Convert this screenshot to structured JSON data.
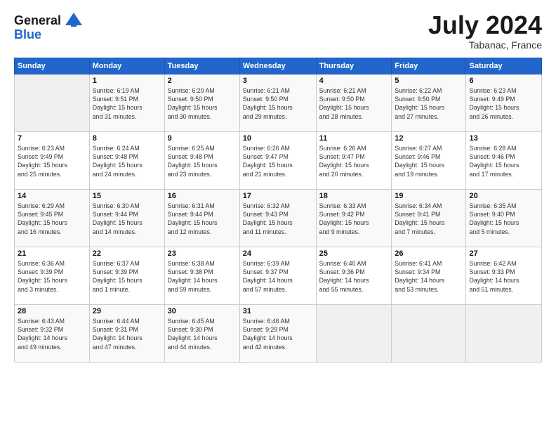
{
  "logo": {
    "general": "General",
    "blue": "Blue"
  },
  "title": "July 2024",
  "location": "Tabanac, France",
  "days_of_week": [
    "Sunday",
    "Monday",
    "Tuesday",
    "Wednesday",
    "Thursday",
    "Friday",
    "Saturday"
  ],
  "weeks": [
    [
      {
        "day": "",
        "detail": ""
      },
      {
        "day": "1",
        "detail": "Sunrise: 6:19 AM\nSunset: 9:51 PM\nDaylight: 15 hours\nand 31 minutes."
      },
      {
        "day": "2",
        "detail": "Sunrise: 6:20 AM\nSunset: 9:50 PM\nDaylight: 15 hours\nand 30 minutes."
      },
      {
        "day": "3",
        "detail": "Sunrise: 6:21 AM\nSunset: 9:50 PM\nDaylight: 15 hours\nand 29 minutes."
      },
      {
        "day": "4",
        "detail": "Sunrise: 6:21 AM\nSunset: 9:50 PM\nDaylight: 15 hours\nand 28 minutes."
      },
      {
        "day": "5",
        "detail": "Sunrise: 6:22 AM\nSunset: 9:50 PM\nDaylight: 15 hours\nand 27 minutes."
      },
      {
        "day": "6",
        "detail": "Sunrise: 6:23 AM\nSunset: 9:49 PM\nDaylight: 15 hours\nand 26 minutes."
      }
    ],
    [
      {
        "day": "7",
        "detail": "Sunrise: 6:23 AM\nSunset: 9:49 PM\nDaylight: 15 hours\nand 25 minutes."
      },
      {
        "day": "8",
        "detail": "Sunrise: 6:24 AM\nSunset: 9:48 PM\nDaylight: 15 hours\nand 24 minutes."
      },
      {
        "day": "9",
        "detail": "Sunrise: 6:25 AM\nSunset: 9:48 PM\nDaylight: 15 hours\nand 23 minutes."
      },
      {
        "day": "10",
        "detail": "Sunrise: 6:26 AM\nSunset: 9:47 PM\nDaylight: 15 hours\nand 21 minutes."
      },
      {
        "day": "11",
        "detail": "Sunrise: 6:26 AM\nSunset: 9:47 PM\nDaylight: 15 hours\nand 20 minutes."
      },
      {
        "day": "12",
        "detail": "Sunrise: 6:27 AM\nSunset: 9:46 PM\nDaylight: 15 hours\nand 19 minutes."
      },
      {
        "day": "13",
        "detail": "Sunrise: 6:28 AM\nSunset: 9:46 PM\nDaylight: 15 hours\nand 17 minutes."
      }
    ],
    [
      {
        "day": "14",
        "detail": "Sunrise: 6:29 AM\nSunset: 9:45 PM\nDaylight: 15 hours\nand 16 minutes."
      },
      {
        "day": "15",
        "detail": "Sunrise: 6:30 AM\nSunset: 9:44 PM\nDaylight: 15 hours\nand 14 minutes."
      },
      {
        "day": "16",
        "detail": "Sunrise: 6:31 AM\nSunset: 9:44 PM\nDaylight: 15 hours\nand 12 minutes."
      },
      {
        "day": "17",
        "detail": "Sunrise: 6:32 AM\nSunset: 9:43 PM\nDaylight: 15 hours\nand 11 minutes."
      },
      {
        "day": "18",
        "detail": "Sunrise: 6:33 AM\nSunset: 9:42 PM\nDaylight: 15 hours\nand 9 minutes."
      },
      {
        "day": "19",
        "detail": "Sunrise: 6:34 AM\nSunset: 9:41 PM\nDaylight: 15 hours\nand 7 minutes."
      },
      {
        "day": "20",
        "detail": "Sunrise: 6:35 AM\nSunset: 9:40 PM\nDaylight: 15 hours\nand 5 minutes."
      }
    ],
    [
      {
        "day": "21",
        "detail": "Sunrise: 6:36 AM\nSunset: 9:39 PM\nDaylight: 15 hours\nand 3 minutes."
      },
      {
        "day": "22",
        "detail": "Sunrise: 6:37 AM\nSunset: 9:39 PM\nDaylight: 15 hours\nand 1 minute."
      },
      {
        "day": "23",
        "detail": "Sunrise: 6:38 AM\nSunset: 9:38 PM\nDaylight: 14 hours\nand 59 minutes."
      },
      {
        "day": "24",
        "detail": "Sunrise: 6:39 AM\nSunset: 9:37 PM\nDaylight: 14 hours\nand 57 minutes."
      },
      {
        "day": "25",
        "detail": "Sunrise: 6:40 AM\nSunset: 9:36 PM\nDaylight: 14 hours\nand 55 minutes."
      },
      {
        "day": "26",
        "detail": "Sunrise: 6:41 AM\nSunset: 9:34 PM\nDaylight: 14 hours\nand 53 minutes."
      },
      {
        "day": "27",
        "detail": "Sunrise: 6:42 AM\nSunset: 9:33 PM\nDaylight: 14 hours\nand 51 minutes."
      }
    ],
    [
      {
        "day": "28",
        "detail": "Sunrise: 6:43 AM\nSunset: 9:32 PM\nDaylight: 14 hours\nand 49 minutes."
      },
      {
        "day": "29",
        "detail": "Sunrise: 6:44 AM\nSunset: 9:31 PM\nDaylight: 14 hours\nand 47 minutes."
      },
      {
        "day": "30",
        "detail": "Sunrise: 6:45 AM\nSunset: 9:30 PM\nDaylight: 14 hours\nand 44 minutes."
      },
      {
        "day": "31",
        "detail": "Sunrise: 6:46 AM\nSunset: 9:29 PM\nDaylight: 14 hours\nand 42 minutes."
      },
      {
        "day": "",
        "detail": ""
      },
      {
        "day": "",
        "detail": ""
      },
      {
        "day": "",
        "detail": ""
      }
    ]
  ]
}
